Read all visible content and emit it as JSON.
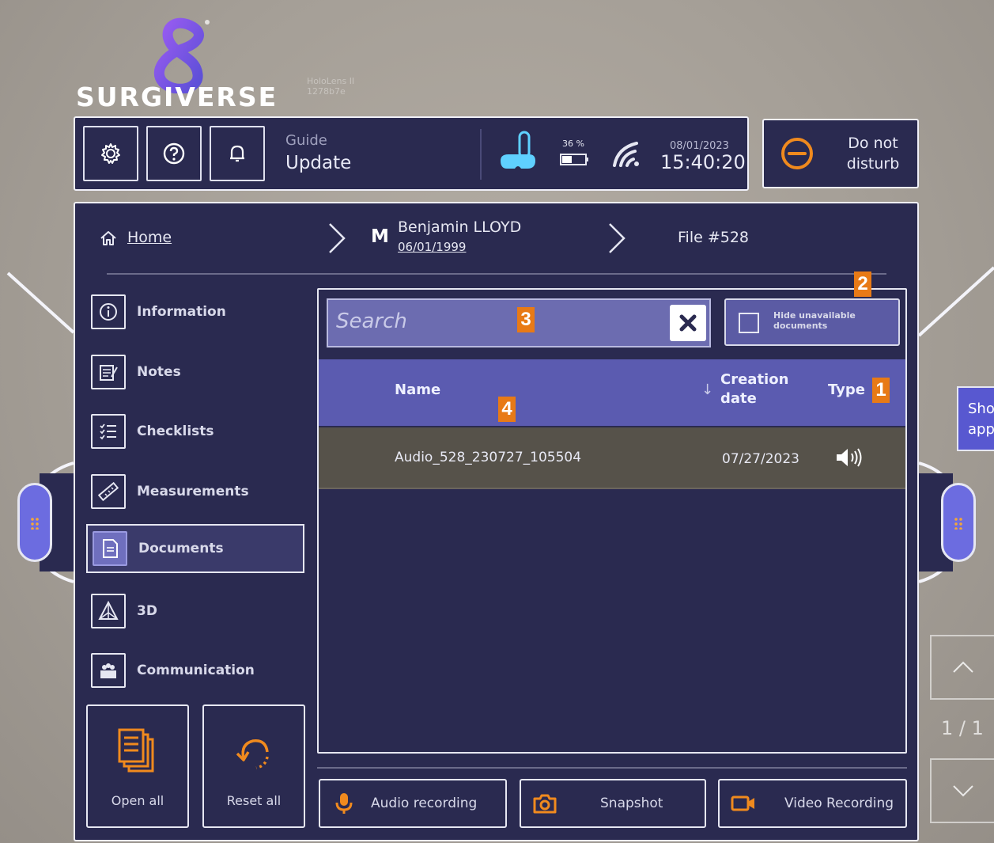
{
  "brand": {
    "name": "SURGIVERSE",
    "subtitle_line1": "HoloLens II",
    "subtitle_line2": "1278b7e"
  },
  "topbar": {
    "settings_icon": "gear-icon",
    "help_icon": "question-icon",
    "notifications_icon": "bell-icon",
    "guide_label": "Guide",
    "guide_value": "Update",
    "battery_percent": "36 %",
    "date": "08/01/2023",
    "time": "15:40:20",
    "accent_color": "#5fd0ff"
  },
  "dnd": {
    "label_line1": "Do not",
    "label_line2": "disturb",
    "icon_color": "#f08a1e"
  },
  "breadcrumb": {
    "home": "Home",
    "gender": "M",
    "patient_name": "Benjamin LLOYD",
    "patient_dob": "06/01/1999",
    "file": "File #528"
  },
  "sidebar": {
    "items": [
      {
        "label": "Information",
        "icon": "info-icon",
        "active": false
      },
      {
        "label": "Notes",
        "icon": "notes-icon",
        "active": false
      },
      {
        "label": "Checklists",
        "icon": "checklist-icon",
        "active": false
      },
      {
        "label": "Measurements",
        "icon": "ruler-icon",
        "active": false
      },
      {
        "label": "Documents",
        "icon": "document-icon",
        "active": true
      },
      {
        "label": "3D",
        "icon": "3d-icon",
        "active": false
      },
      {
        "label": "Communication",
        "icon": "communication-icon",
        "active": false
      }
    ],
    "open_all": "Open all",
    "reset_all": "Reset all"
  },
  "documents": {
    "search_placeholder": "Search",
    "hide_unavailable": "Hide unavailable documents",
    "columns": {
      "name": "Name",
      "sort_indicator": "↓",
      "creation_date": "Creation date",
      "type": "Type"
    },
    "rows": [
      {
        "name": "Audio_528_230727_105504",
        "creation_date": "07/27/2023",
        "type_icon": "speaker-icon"
      }
    ]
  },
  "actions": {
    "audio_recording": "Audio recording",
    "snapshot": "Snapshot",
    "video_recording": "Video Recording"
  },
  "markers": {
    "m1": "1",
    "m2": "2",
    "m3": "3",
    "m4": "4"
  },
  "right_panel": {
    "tab_text_line1": "Sho",
    "tab_text_line2": "app",
    "pager": "1 / 1"
  }
}
